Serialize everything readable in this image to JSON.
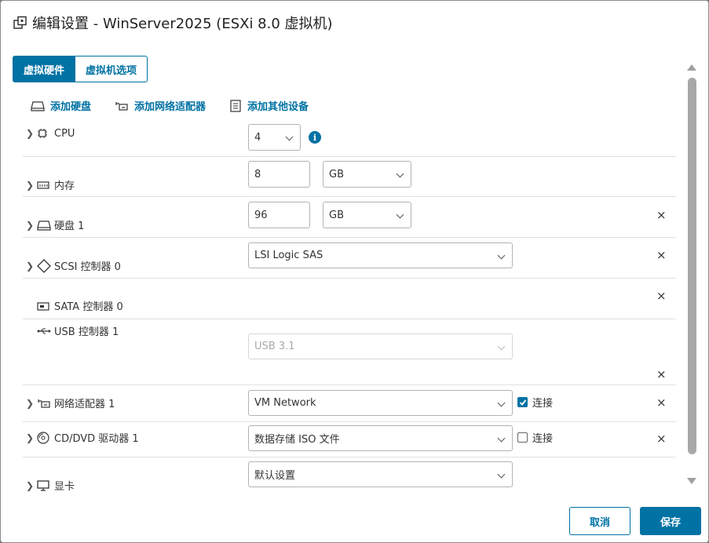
{
  "dialog": {
    "title": "编辑设置 - WinServer2025 (ESXi 8.0 虚拟机)"
  },
  "tabs": [
    {
      "label": "虚拟硬件",
      "active": true
    },
    {
      "label": "虚拟机选项",
      "active": false
    }
  ],
  "actions": {
    "add_disk": "添加硬盘",
    "add_nic": "添加网络适配器",
    "add_other": "添加其他设备"
  },
  "devices": {
    "cpu": {
      "label": "CPU",
      "value": "4"
    },
    "memory": {
      "label": "内存",
      "value": "8",
      "unit": "GB"
    },
    "disk": {
      "label": "硬盘 1",
      "value": "96",
      "unit": "GB"
    },
    "scsi": {
      "label": "SCSI 控制器 0",
      "value": "LSI Logic SAS"
    },
    "sata": {
      "label": "SATA 控制器 0"
    },
    "usb": {
      "label": "USB 控制器 1",
      "value": "USB 3.1"
    },
    "nic": {
      "label": "网络适配器 1",
      "value": "VM Network",
      "connect_label": "连接",
      "connected": true
    },
    "cdrom": {
      "label": "CD/DVD 驱动器 1",
      "value": "数据存储 ISO 文件",
      "connect_label": "连接",
      "connected": false
    },
    "video": {
      "label": "显卡",
      "value": "默认设置"
    }
  },
  "icons": {
    "close": "×",
    "info": "i"
  },
  "buttons": {
    "cancel": "取消",
    "save": "保存"
  },
  "colors": {
    "accent": "#0072a3"
  }
}
